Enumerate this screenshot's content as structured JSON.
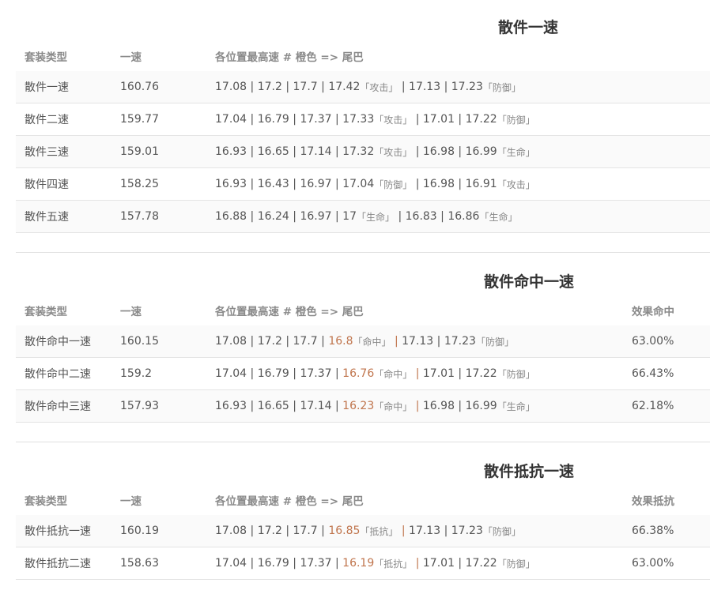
{
  "sections": [
    {
      "title": "散件一速",
      "headers": [
        "套装类型",
        "一速",
        "各位置最高速 # 橙色 => 尾巴"
      ],
      "rows": [
        {
          "type": "散件一速",
          "speed": "160.76",
          "positions": [
            [
              "17.08",
              ""
            ],
            [
              "17.2",
              ""
            ],
            [
              "17.7",
              ""
            ],
            [
              "17.42",
              "「攻击」"
            ],
            [
              "17.13",
              ""
            ],
            [
              "17.23",
              "「防御」"
            ]
          ]
        },
        {
          "type": "散件二速",
          "speed": "159.77",
          "positions": [
            [
              "17.04",
              ""
            ],
            [
              "16.79",
              ""
            ],
            [
              "17.37",
              ""
            ],
            [
              "17.33",
              "「攻击」"
            ],
            [
              "17.01",
              ""
            ],
            [
              "17.22",
              "「防御」"
            ]
          ]
        },
        {
          "type": "散件三速",
          "speed": "159.01",
          "positions": [
            [
              "16.93",
              ""
            ],
            [
              "16.65",
              ""
            ],
            [
              "17.14",
              ""
            ],
            [
              "17.32",
              "「攻击」"
            ],
            [
              "16.98",
              ""
            ],
            [
              "16.99",
              "「生命」"
            ]
          ]
        },
        {
          "type": "散件四速",
          "speed": "158.25",
          "positions": [
            [
              "16.93",
              ""
            ],
            [
              "16.43",
              ""
            ],
            [
              "16.97",
              ""
            ],
            [
              "17.04",
              "「防御」"
            ],
            [
              "16.98",
              ""
            ],
            [
              "16.91",
              "「攻击」"
            ]
          ]
        },
        {
          "type": "散件五速",
          "speed": "157.78",
          "positions": [
            [
              "16.88",
              ""
            ],
            [
              "16.24",
              ""
            ],
            [
              "16.97",
              ""
            ],
            [
              "17",
              "「生命」"
            ],
            [
              "16.83",
              ""
            ],
            [
              "16.86",
              "「生命」"
            ]
          ]
        }
      ]
    },
    {
      "title": "散件命中一速",
      "headers": [
        "套装类型",
        "一速",
        "各位置最高速 # 橙色 => 尾巴",
        "效果命中"
      ],
      "rows": [
        {
          "type": "散件命中一速",
          "speed": "160.15",
          "positions": [
            [
              "17.08",
              ""
            ],
            [
              "17.2",
              ""
            ],
            [
              "17.7",
              ""
            ],
            [
              "16.8",
              "「命中」",
              "hl"
            ],
            [
              "17.13",
              ""
            ],
            [
              "17.23",
              "「防御」"
            ]
          ],
          "extra": "63.00%"
        },
        {
          "type": "散件命中二速",
          "speed": "159.2",
          "positions": [
            [
              "17.04",
              ""
            ],
            [
              "16.79",
              ""
            ],
            [
              "17.37",
              ""
            ],
            [
              "16.76",
              "「命中」",
              "hl"
            ],
            [
              "17.01",
              ""
            ],
            [
              "17.22",
              "「防御」"
            ]
          ],
          "extra": "66.43%"
        },
        {
          "type": "散件命中三速",
          "speed": "157.93",
          "positions": [
            [
              "16.93",
              ""
            ],
            [
              "16.65",
              ""
            ],
            [
              "17.14",
              ""
            ],
            [
              "16.23",
              "「命中」",
              "hl"
            ],
            [
              "16.98",
              ""
            ],
            [
              "16.99",
              "「生命」"
            ]
          ],
          "extra": "62.18%"
        }
      ]
    },
    {
      "title": "散件抵抗一速",
      "headers": [
        "套装类型",
        "一速",
        "各位置最高速 # 橙色 => 尾巴",
        "效果抵抗"
      ],
      "rows": [
        {
          "type": "散件抵抗一速",
          "speed": "160.19",
          "positions": [
            [
              "17.08",
              ""
            ],
            [
              "17.2",
              ""
            ],
            [
              "17.7",
              ""
            ],
            [
              "16.85",
              "「抵抗」",
              "hl"
            ],
            [
              "17.13",
              ""
            ],
            [
              "17.23",
              "「防御」"
            ]
          ],
          "extra": "66.38%"
        },
        {
          "type": "散件抵抗二速",
          "speed": "158.63",
          "positions": [
            [
              "17.04",
              ""
            ],
            [
              "16.79",
              ""
            ],
            [
              "17.37",
              ""
            ],
            [
              "16.19",
              "「抵抗」",
              "hl"
            ],
            [
              "17.01",
              ""
            ],
            [
              "17.22",
              "「防御」"
            ]
          ],
          "extra": "63.00%"
        }
      ]
    }
  ],
  "colors": {
    "highlight": "#c0754d",
    "header_text": "#8a8a8a",
    "body_text": "#555555",
    "title_text": "#333333",
    "row_alt_bg": "#fafafa",
    "border": "#e4e4e4"
  }
}
